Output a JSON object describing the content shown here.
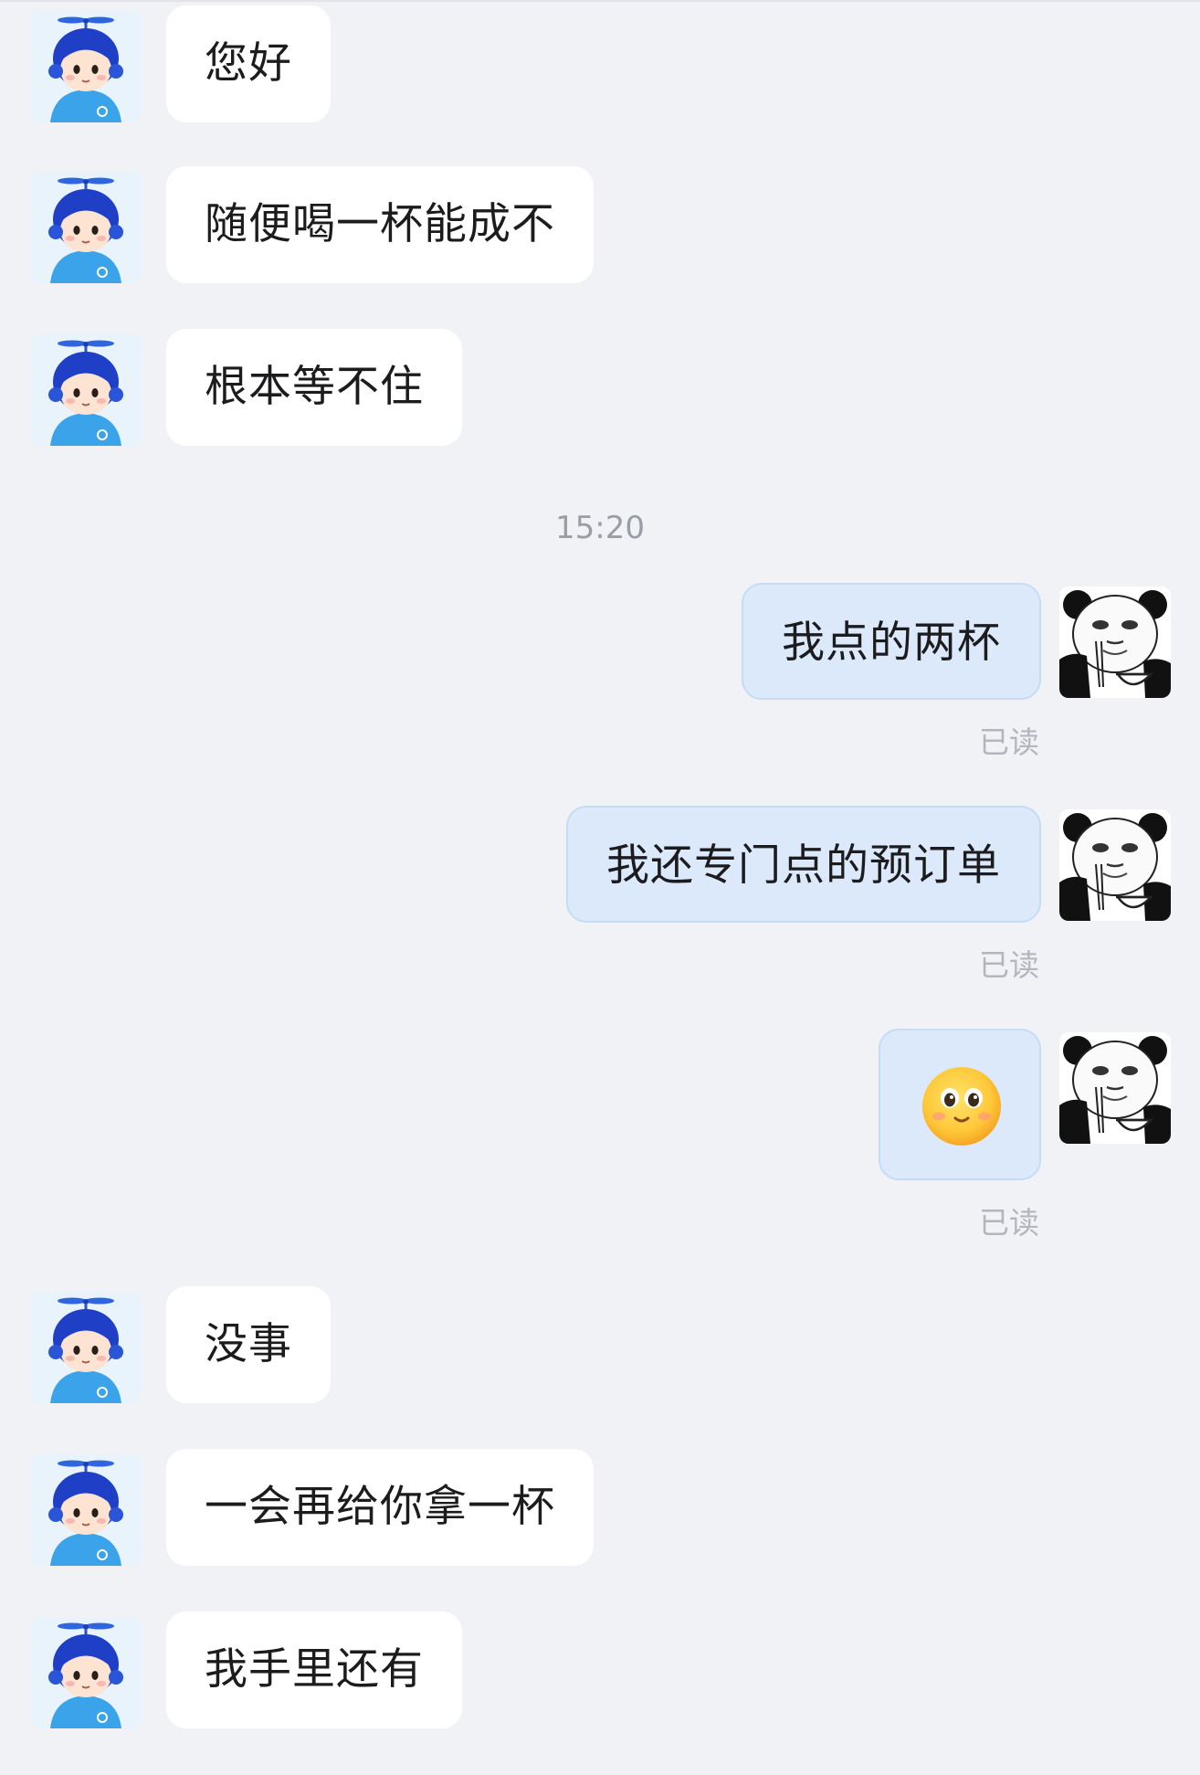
{
  "timestamp": "15:20",
  "messages": [
    {
      "side": "left",
      "text": "您好"
    },
    {
      "side": "left",
      "text": "随便喝一杯能成不"
    },
    {
      "side": "left",
      "text": "根本等不住"
    },
    {
      "side": "right",
      "text": "我点的两杯",
      "status": "已读"
    },
    {
      "side": "right",
      "text": "我还专门点的预订单",
      "status": "已读"
    },
    {
      "side": "right",
      "emoji": "smiling-face-with-big-eyes-emoji",
      "status": "已读"
    },
    {
      "side": "left",
      "text": "没事"
    },
    {
      "side": "left",
      "text": "一会再给你拿一杯"
    },
    {
      "side": "left",
      "text": "我手里还有"
    }
  ],
  "avatars": {
    "contact": "cartoon-boy-propeller-cap-avatar",
    "self": "panda-meme-avatar"
  },
  "colors": {
    "background": "#f1f2f6",
    "incoming_bubble": "#ffffff",
    "outgoing_bubble": "#dbe9fb",
    "read_status": "#b3b6be"
  }
}
